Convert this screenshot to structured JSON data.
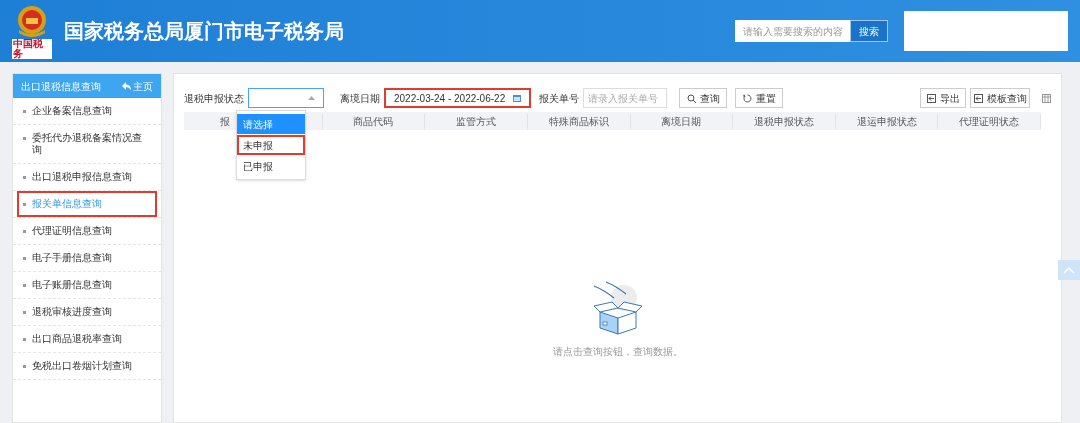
{
  "header": {
    "title": "国家税务总局厦门市电子税务局",
    "logo_caption": "中国税务",
    "search": {
      "placeholder": "请输入需要搜索的内容",
      "button": "搜索"
    }
  },
  "sidebar": {
    "title": "出口退税信息查询",
    "home": "主页",
    "items": [
      {
        "label": "企业备案信息查询",
        "selected": false,
        "highlighted": false
      },
      {
        "label": "委托代办退税备案情况查询",
        "selected": false,
        "highlighted": false
      },
      {
        "label": "出口退税申报信息查询",
        "selected": false,
        "highlighted": false
      },
      {
        "label": "报关单信息查询",
        "selected": true,
        "highlighted": true
      },
      {
        "label": "代理证明信息查询",
        "selected": false,
        "highlighted": false
      },
      {
        "label": "电子手册信息查询",
        "selected": false,
        "highlighted": false
      },
      {
        "label": "电子账册信息查询",
        "selected": false,
        "highlighted": false
      },
      {
        "label": "退税审核进度查询",
        "selected": false,
        "highlighted": false
      },
      {
        "label": "出口商品退税率查询",
        "selected": false,
        "highlighted": false
      },
      {
        "label": "免税出口卷烟计划查询",
        "selected": false,
        "highlighted": false
      }
    ]
  },
  "filters": {
    "status_label": "退税申报状态",
    "date_label": "离境日期",
    "date_value": "2022-03-24 - 2022-06-22",
    "date_highlighted": true,
    "number_label": "报关单号",
    "number_placeholder": "请录入报关单号",
    "query": "查询",
    "reset": "重置",
    "export": "导出",
    "template_query": "模板查询"
  },
  "dropdown": {
    "options": [
      {
        "label": "请选择",
        "selected": true,
        "highlighted": false
      },
      {
        "label": "未申报",
        "selected": false,
        "highlighted": true
      },
      {
        "label": "已申报",
        "selected": false,
        "highlighted": false
      }
    ]
  },
  "table": {
    "columns": [
      "报",
      "商品代码",
      "监管方式",
      "特殊商品标识",
      "离境日期",
      "退税申报状态",
      "退运申报状态",
      "代理证明状态"
    ]
  },
  "empty_message": "请点击查询按钮，查询数据。"
}
